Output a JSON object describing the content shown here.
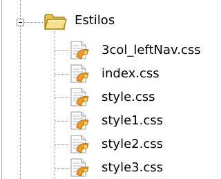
{
  "tree": {
    "folder": {
      "label": "Estilos",
      "icon": "folder-open-icon",
      "expanded": true,
      "expander_icon": "collapse-minus-icon"
    },
    "files": [
      {
        "label": "3col_leftNav.css",
        "icon": "css-file-icon"
      },
      {
        "label": "index.css",
        "icon": "css-file-icon"
      },
      {
        "label": "style.css",
        "icon": "css-file-icon"
      },
      {
        "label": "style1.css",
        "icon": "css-file-icon"
      },
      {
        "label": "style2.css",
        "icon": "css-file-icon"
      },
      {
        "label": "style3.css",
        "icon": "css-file-icon"
      }
    ]
  },
  "colors": {
    "background": "#ffffff",
    "guide_lines": "#8c8c8c",
    "folder_fill": "#f2d774",
    "folder_outline": "#b8961e",
    "file_accent": "#f29a1f"
  }
}
